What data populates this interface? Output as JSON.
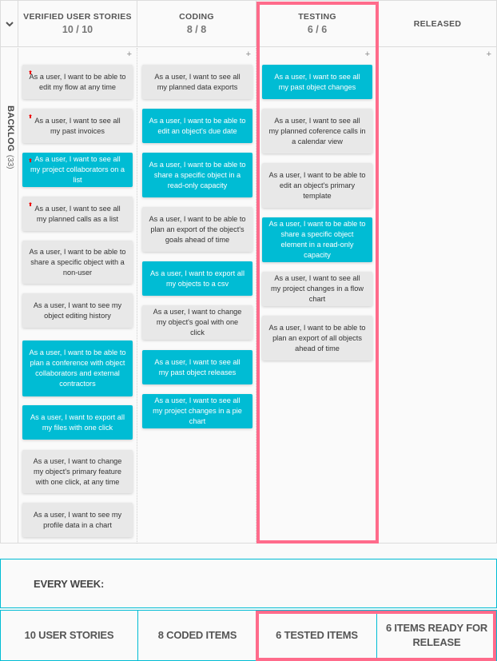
{
  "board": {
    "columns": [
      {
        "title": "VERIFIED USER STORIES",
        "count": "10 / 10",
        "add": "+"
      },
      {
        "title": "CODING",
        "count": "8 / 8",
        "add": "+"
      },
      {
        "title": "TESTING",
        "count": "6 / 6",
        "add": "+"
      },
      {
        "title": "RELEASED",
        "add": "+"
      }
    ],
    "lane": {
      "name": "BACKLOG",
      "count": "(33)"
    },
    "highlight_color": "#ff6b8b",
    "card_colors": {
      "gray": "#e8e8e8",
      "blue": "#00bcd4"
    },
    "cards": {
      "verified": [
        {
          "text": "As a user, I want to be able to edit my flow at any time",
          "style": "gray",
          "flag": true
        },
        {
          "text": "As a user, I want to see all my past invoices",
          "style": "gray",
          "flag": true
        },
        {
          "text": "As a user, I want to see all my project collaborators on a list",
          "style": "blue",
          "flag": true
        },
        {
          "text": "As a user, I want to see all my planned calls as a list",
          "style": "gray",
          "flag": true
        },
        {
          "text": "As a user, I want to be able to share a specific object with a non-user",
          "style": "gray"
        },
        {
          "text": "As a user, I want to see my object editing history",
          "style": "gray"
        },
        {
          "text": "As a user, I want to be able to plan a conference with object collaborators and external contractors",
          "style": "blue"
        },
        {
          "text": "As a user, I want to export all my files with one click",
          "style": "blue"
        },
        {
          "text": "As a user, I want to change my object's primary feature with one click, at any time",
          "style": "gray"
        },
        {
          "text": "As a user, I want to see my profile data in a chart",
          "style": "gray"
        }
      ],
      "coding": [
        {
          "text": "As a user, I want to see all my planned data exports",
          "style": "gray"
        },
        {
          "text": "As a user, I want to be able to edit an object's due date",
          "style": "blue"
        },
        {
          "text": "As a user, I want to be able to share a specific object in a read-only capacity",
          "style": "blue"
        },
        {
          "text": "As a user, I want to be able to plan an export of the object's goals ahead of time",
          "style": "gray"
        },
        {
          "text": "As a user, I want to export all my objects to a csv",
          "style": "blue"
        },
        {
          "text": "As a user, I want to change my object's goal with one click",
          "style": "gray"
        },
        {
          "text": "As a user, I want to see all my past object releases",
          "style": "blue"
        },
        {
          "text": "As a user, I want to see all my project changes in a pie chart",
          "style": "blue"
        }
      ],
      "testing": [
        {
          "text": "As a user, I want to see all my past object changes",
          "style": "blue"
        },
        {
          "text": "As a user, I want to see all my planned coference calls in a calendar view",
          "style": "gray"
        },
        {
          "text": "As a user, I want to be able to edit an object's primary template",
          "style": "gray"
        },
        {
          "text": "As a user, I want to be able to share a specific object element in a read-only capacity",
          "style": "blue"
        },
        {
          "text": "As a user, I want to see all my project changes in a flow chart",
          "style": "gray"
        },
        {
          "text": "As a user, I want to be able to plan an export of all objects ahead of time",
          "style": "gray"
        }
      ],
      "released": []
    }
  },
  "summary": {
    "label": "EVERY WEEK:",
    "stats": [
      "10 USER STORIES",
      "8 CODED ITEMS",
      "6 TESTED ITEMS",
      "6 ITEMS READY FOR RELEASE"
    ],
    "border_color": "#00bcd4"
  }
}
